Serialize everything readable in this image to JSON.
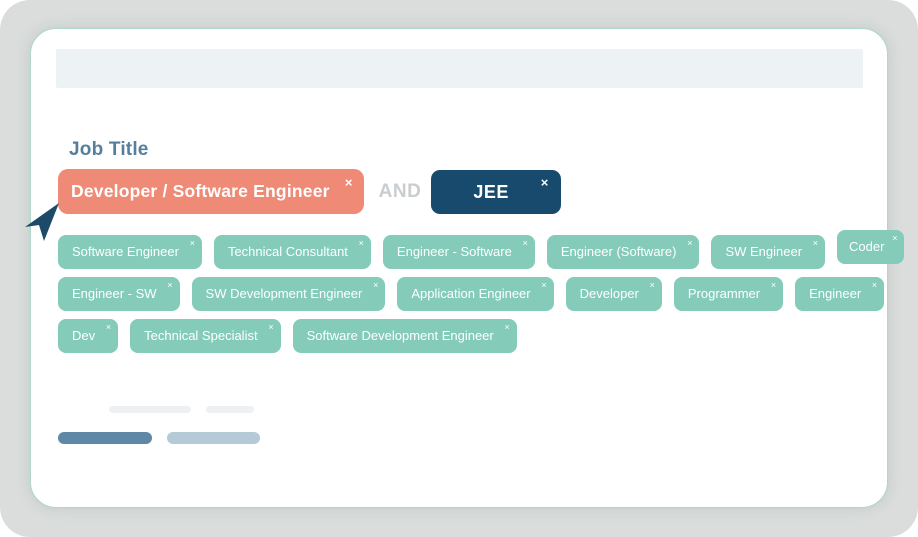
{
  "job_title": {
    "label": "Job Title",
    "operator": "AND",
    "selected_terms": [
      {
        "label": "Developer / Software Engineer",
        "style": "primary"
      },
      {
        "label": "JEE",
        "style": "secondary"
      }
    ]
  },
  "synonyms": {
    "rows": [
      [
        "Software Engineer",
        "Technical Consultant",
        "Engineer - Software",
        "Engineer (Software)",
        "SW Engineer",
        "Coder"
      ],
      [
        "Engineer - SW",
        "SW Development Engineer",
        "Application Engineer",
        "Developer",
        "Programmer",
        "Engineer"
      ],
      [
        "Dev",
        "Technical Specialist",
        "Software Development Engineer"
      ]
    ]
  },
  "icons": {
    "remove_glyph": "×",
    "cursor": "navigation-arrow"
  },
  "colors": {
    "primary_chip": "#ee8a75",
    "secondary_chip": "#174a6d",
    "synonym_chip": "#84cbb9",
    "label_text": "#54809e",
    "operator_text": "#c9cdd0",
    "topbar": "#edf2f5",
    "frame_background": "#dadddc",
    "card_border": "#aed8cc",
    "skeleton_dark": "#5e88a5",
    "skeleton_light_blue": "#b5cad7",
    "skeleton_gray": "#edf1f4",
    "cursor_arrow": "#1c4a68"
  }
}
